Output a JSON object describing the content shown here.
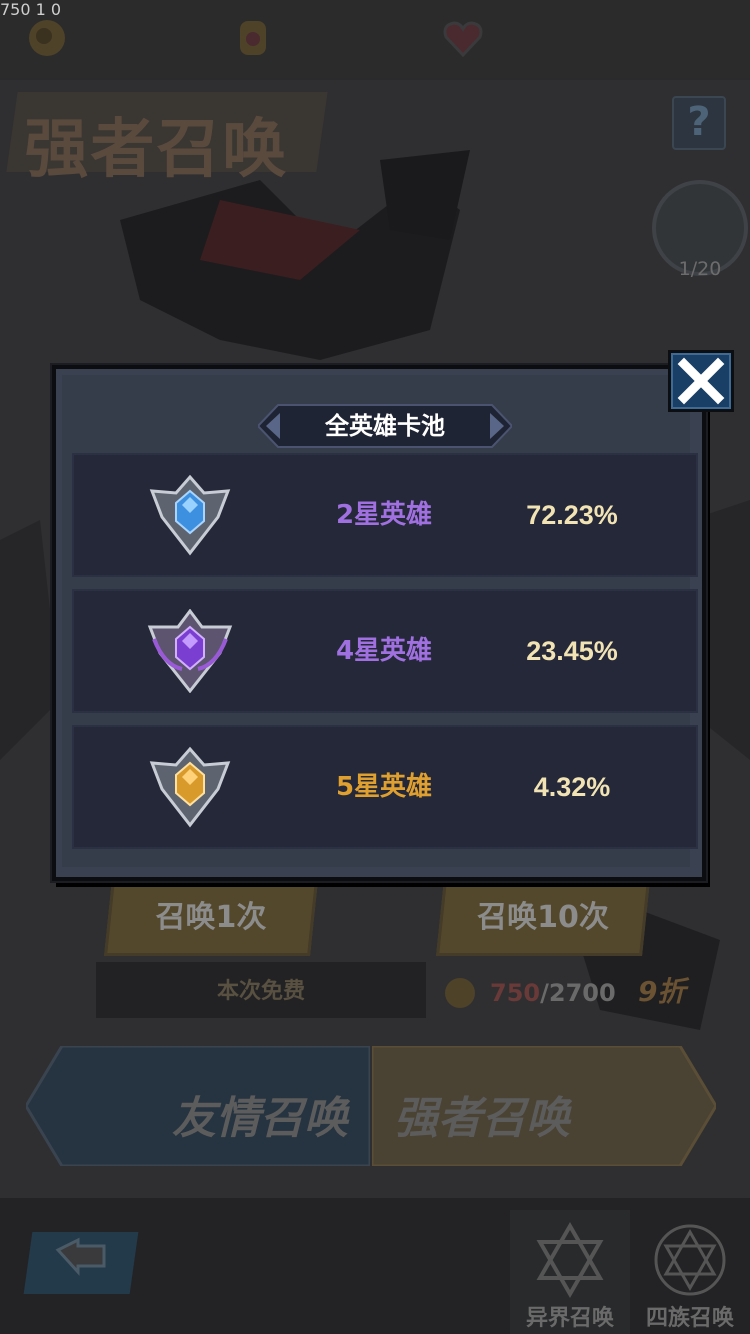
{
  "resources": [
    {
      "icon": "gold-coin-icon",
      "value": "750"
    },
    {
      "icon": "scroll-bag-icon",
      "value": "1"
    },
    {
      "icon": "heart-icon",
      "value": "0"
    }
  ],
  "page": {
    "title": "强者召唤",
    "help_icon": "question-icon",
    "counter": "1/20"
  },
  "summon": {
    "once_label": "召唤1次",
    "ten_label": "召唤10次",
    "free_text": "本次免费",
    "cost_have": "750",
    "cost_total": "/2700",
    "discount": "9折"
  },
  "modes": {
    "friend_label": "友情召唤",
    "strong_label": "强者召唤"
  },
  "tabs": [
    {
      "label": "异界召唤",
      "icon": "hexagram-icon"
    },
    {
      "label": "四族召唤",
      "icon": "hexagram-circle-icon"
    }
  ],
  "modal": {
    "title": "全英雄卡池",
    "rows": [
      {
        "name": "2星英雄",
        "percent": "72.23%",
        "color": "#a070e0",
        "emblem": "blue-gem-emblem-icon"
      },
      {
        "name": "4星英雄",
        "percent": "23.45%",
        "color": "#a070e0",
        "emblem": "purple-gem-emblem-icon"
      },
      {
        "name": "5星英雄",
        "percent": "4.32%",
        "color": "#e0a030",
        "emblem": "gold-gem-emblem-icon"
      }
    ]
  },
  "colors": {
    "modal_bg": "#353c4a",
    "row_bg": "#242838",
    "percent_text": "#f1e3b4",
    "close_button": "#1a3f66"
  }
}
